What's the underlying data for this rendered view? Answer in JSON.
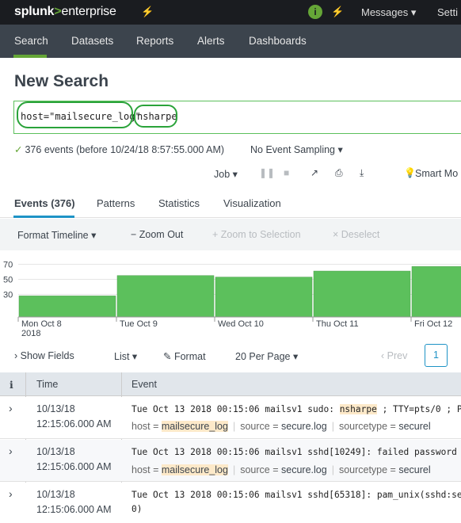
{
  "topbar": {
    "logo_splunk": "splunk",
    "logo_gt": ">",
    "logo_enterprise": "enterprise",
    "activity_icon": "activity-icon",
    "info_icon": "i",
    "messages": "Messages ▾",
    "settings": "Setti"
  },
  "nav": {
    "tabs": [
      "Search",
      "Datasets",
      "Reports",
      "Alerts",
      "Dashboards"
    ]
  },
  "page": {
    "title": "New Search",
    "search_part1": "host=\"mailsecure_log\"",
    "search_part2": "nsharpe",
    "events_status": "376 events (before 10/24/18 8:57:55.000 AM)",
    "sampling": "No Event Sampling ▾",
    "job": "Job ▾",
    "smart_mode": "Smart Mo"
  },
  "result_tabs": [
    "Events (376)",
    "Patterns",
    "Statistics",
    "Visualization"
  ],
  "timeline": {
    "format": "Format Timeline ▾",
    "zoom_out": "− Zoom Out",
    "zoom_selection": "+ Zoom to Selection",
    "deselect": "× Deselect"
  },
  "chart_data": {
    "type": "bar",
    "categories": [
      "Mon Oct 8\n2018",
      "Tue Oct 9",
      "Wed Oct 10",
      "Thu Oct 11",
      "Fri Oct 12"
    ],
    "values": [
      28,
      55,
      53,
      61,
      67
    ],
    "ylim": [
      0,
      80
    ],
    "yticks": [
      30,
      50,
      70
    ],
    "tick_labels": [
      "30",
      "50",
      "70"
    ],
    "x_labels": [
      "Mon Oct 8",
      "Tue Oct 9",
      "Wed Oct 10",
      "Thu Oct 11",
      "Fri Oct 12"
    ],
    "x_sublabel": "2018",
    "bar_color": "#5cc05c"
  },
  "controls": {
    "show_fields": "Show Fields",
    "list": "List ▾",
    "format": "Format",
    "per_page": "20 Per Page ▾",
    "prev": "‹ Prev",
    "page": "1"
  },
  "table": {
    "headers": {
      "info": "i",
      "time": "Time",
      "event": "Event"
    },
    "rows": [
      {
        "date": "10/13/18",
        "time": "12:15:06.000 AM",
        "event_pre": "Tue Oct 13 2018 00:15:06 mailsv1 sudo: ",
        "event_hl": "nsharpe",
        "event_post": " ;  TTY=pts/0 ; P",
        "host_label": "host =",
        "host": "mailsecure_log",
        "source_label": "source =",
        "source": "secure.log",
        "sourcetype_label": "sourcetype =",
        "sourcetype": "securel"
      },
      {
        "date": "10/13/18",
        "time": "12:15:06.000 AM",
        "event_pre": "Tue Oct 13 2018 00:15:06 mailsv1 sshd[10249]: failed password f",
        "host_label": "host =",
        "host": "mailsecure_log",
        "source_label": "source =",
        "source": "secure.log",
        "sourcetype_label": "sourcetype =",
        "sourcetype": "securel"
      },
      {
        "date": "10/13/18",
        "time": "12:15:06.000 AM",
        "event_pre": "Tue Oct 13 2018 00:15:06 mailsv1 sshd[65318]: pam_unix(sshd:ses",
        "event_line2": "0)"
      }
    ]
  }
}
